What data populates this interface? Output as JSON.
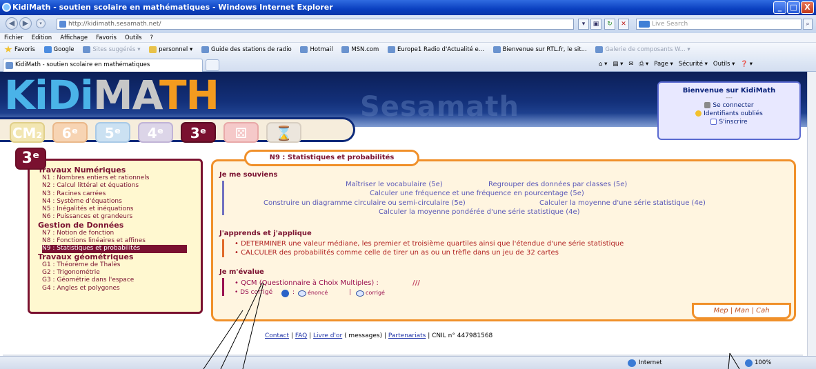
{
  "window": {
    "title": "KidiMath - soutien scolaire en mathématiques - Windows Internet Explorer",
    "min": "_",
    "max": "□",
    "close": "X"
  },
  "address": {
    "url": "http://kidimath.sesamath.net/",
    "search_placeholder": "Live Search"
  },
  "menu": [
    "Fichier",
    "Edition",
    "Affichage",
    "Favoris",
    "Outils",
    "?"
  ],
  "favorites": {
    "label": "Favoris",
    "items": [
      "Google",
      "Sites suggérés ▾",
      "personnel ▾",
      "Guide des stations de radio",
      "Hotmail",
      "MSN.com",
      "Europe1 Radio d'Actualité e...",
      "Bienvenue sur RTL.fr, le sit...",
      "Galerie de composants W... ▾"
    ]
  },
  "tab": {
    "label": "KidiMath - soutien scolaire en mathématiques"
  },
  "commandbar": [
    "Page ▾",
    "Sécurité ▾",
    "Outils ▾"
  ],
  "site": {
    "logo": {
      "k": "KiDi",
      "m": "MA",
      "th": "TH"
    },
    "watermark": "Sesamath",
    "welcome": {
      "title": "Bienvenue sur KidiMath",
      "dash": "---",
      "links": [
        "Se connecter",
        "Identifiants oubliés",
        "S'inscrire"
      ]
    },
    "levels": [
      "CM₂",
      "6ᵉ",
      "5ᵉ",
      "4ᵉ",
      "3ᵉ",
      "⚄",
      "⌛"
    ],
    "badge": "3ᵉ",
    "leftmenu": {
      "s1": "Travaux Numériques",
      "n": [
        "N1 : Nombres entiers et rationnels",
        "N2 : Calcul littéral et équations",
        "N3 : Racines carrées",
        "N4 : Système d'équations",
        "N5 : Inégalités et inéquations",
        "N6 : Puissances et grandeurs"
      ],
      "s2": "Gestion de Données",
      "d": [
        "N7 : Notion de fonction",
        "N8 : Fonctions linéaires et affines",
        "N9 : Statistiques et probabilités"
      ],
      "s3": "Travaux géométriques",
      "g": [
        "G1 : Théorème de Thalès",
        "G2 : Trigonométrie",
        "G3 : Géométrie dans l'espace",
        "G4 : Angles et polygones"
      ]
    },
    "main": {
      "title": "N9 : Statistiques et probabilités",
      "h1": "Je me souviens",
      "rem": [
        "Maîtriser le vocabulaire (5e)",
        "Regrouper des données par classes (5e)",
        "Calculer une fréquence et une fréquence en pourcentage (5e)",
        "Construire un diagramme circulaire ou semi-circulaire (5e)",
        "Calculer la moyenne d'une série statistique (4e)",
        "Calculer la moyenne pondérée d'une série statistique (4e)"
      ],
      "h2": "J'apprends et j'applique",
      "app": [
        "• DETERMINER une valeur médiane, les premier et troisième quartiles ainsi que l'étendue d'une série statistique",
        "• CALCULER des probabilités comme celle de tirer un as ou un trèfle dans un jeu de 32 cartes"
      ],
      "h3": "Je m'évalue",
      "qcm": "• QCM (Questionnaire à Choix Multiples) :",
      "qcm_mark": "///",
      "ds": "• DS corrigé",
      "ds_sep": ":",
      "enonce": "énoncé",
      "sep": "|",
      "corrige": "corrigé",
      "mep": "Mep | Man | Cah"
    },
    "footer": {
      "contact": "Contact",
      "sep": "|",
      "faq": "FAQ",
      "livre": "Livre d'or",
      "messages": "( messages)",
      "part": "Partenariats",
      "cnil": "| CNIL n° 447981568"
    }
  },
  "status": {
    "zone": "Internet",
    "zoom": "100%"
  },
  "colors": {
    "accent_orange": "#f0902a",
    "maroon": "#7a1130",
    "link": "#5a58b8",
    "navy": "#0d2a7a"
  }
}
